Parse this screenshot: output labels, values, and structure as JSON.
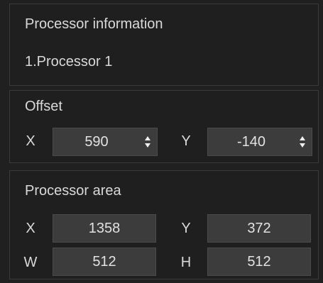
{
  "processor_info": {
    "title": "Processor information",
    "value": "1.Processor 1"
  },
  "offset": {
    "title": "Offset",
    "x_label": "X",
    "x_value": "590",
    "y_label": "Y",
    "y_value": "-140"
  },
  "area": {
    "title": "Processor area",
    "x_label": "X",
    "x_value": "1358",
    "y_label": "Y",
    "y_value": "372",
    "w_label": "W",
    "w_value": "512",
    "h_label": "H",
    "h_value": "512"
  },
  "icons": {
    "spinner": "up-down-arrows-icon"
  }
}
